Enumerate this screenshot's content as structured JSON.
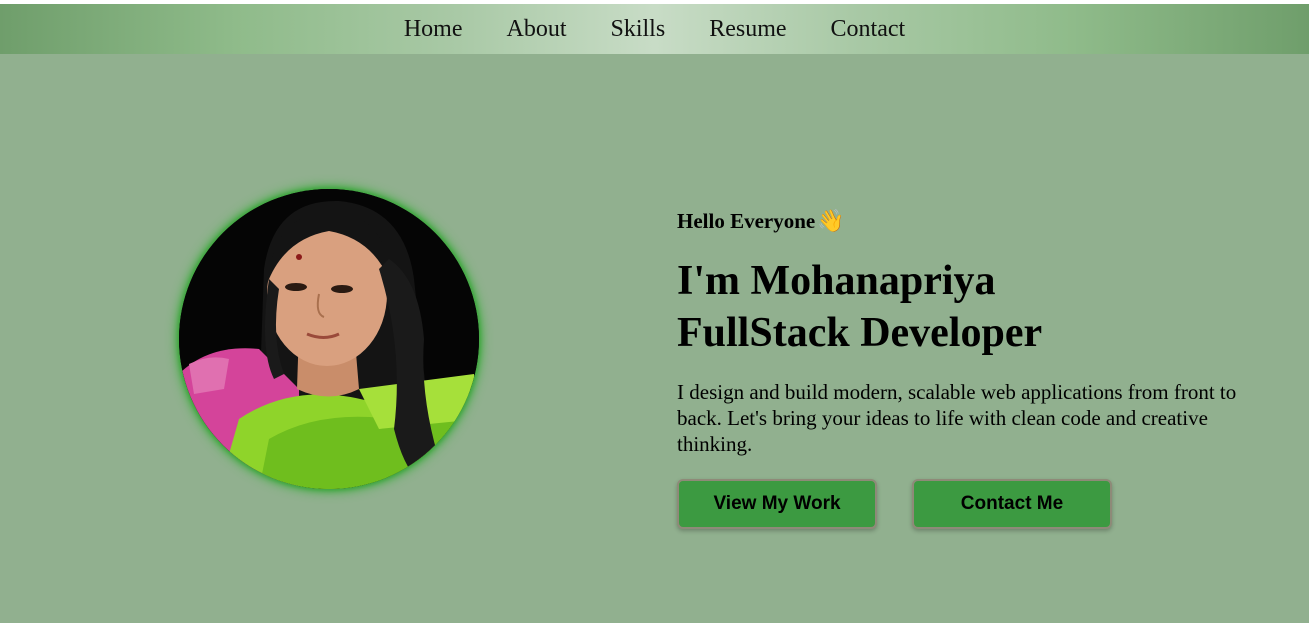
{
  "nav": {
    "items": [
      {
        "label": "Home"
      },
      {
        "label": "About"
      },
      {
        "label": "Skills"
      },
      {
        "label": "Resume"
      },
      {
        "label": "Contact"
      }
    ]
  },
  "hero": {
    "greeting": "Hello Everyone",
    "wave_emoji": "👋",
    "headline_line1": "I'm Mohanapriya",
    "headline_line2": "FullStack Developer",
    "description": "I design and build modern, scalable web applications from front to back. Let's bring your ideas to life with clean code and creative thinking.",
    "primary_button": "View My Work",
    "secondary_button": "Contact Me"
  },
  "colors": {
    "page_background": "#91b08f",
    "button_green": "#3c9a41",
    "avatar_glow": "#3fae3f"
  }
}
